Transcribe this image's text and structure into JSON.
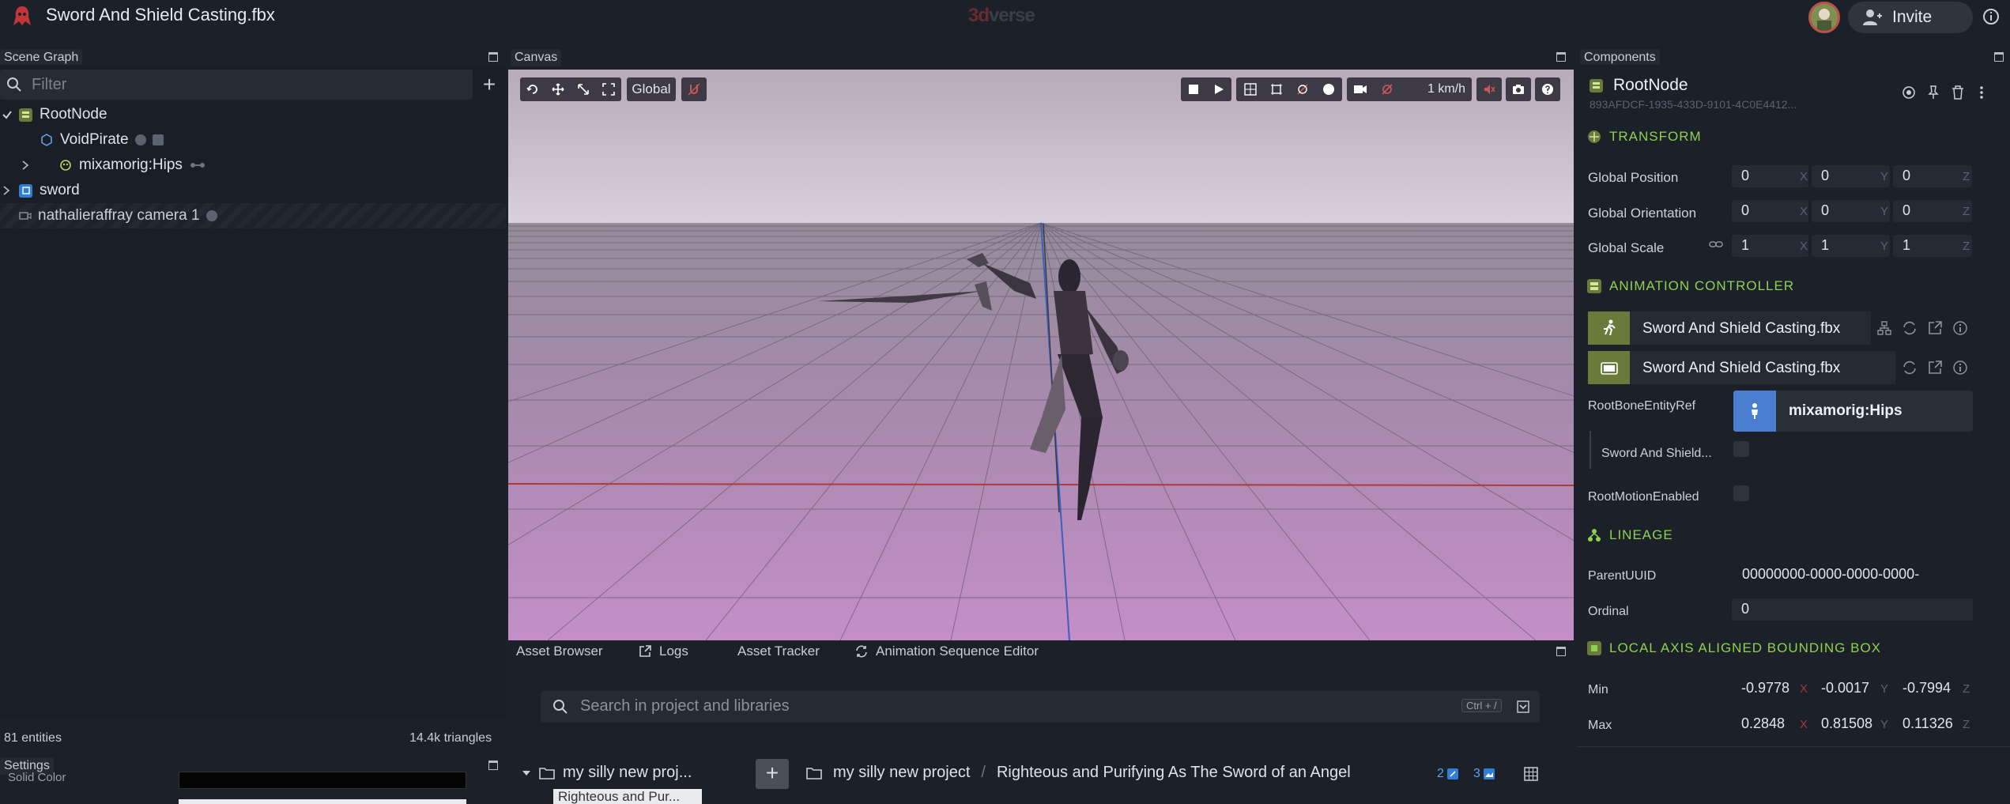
{
  "app": {
    "title": "Sword And Shield Casting.fbx",
    "brand_3d": "3d",
    "brand_rest": "verse",
    "invite_label": "Invite"
  },
  "scene_graph": {
    "tab_label": "Scene Graph",
    "filter_placeholder": "Filter",
    "nodes": [
      {
        "label": "RootNode"
      },
      {
        "label": "VoidPirate"
      },
      {
        "label": "mixamorig:Hips"
      },
      {
        "label": "sword"
      },
      {
        "label": "nathalieraffray camera 1"
      }
    ],
    "entities": "81 entities",
    "triangles": "14.4k triangles"
  },
  "settings": {
    "tab_label": "Settings",
    "solid_color_label": "Solid Color"
  },
  "canvas": {
    "tab_label": "Canvas",
    "space_mode": "Global",
    "speed": "1 km/h"
  },
  "bottom_tabs": [
    "Asset Browser",
    "Logs",
    "Asset Tracker",
    "Animation Sequence Editor"
  ],
  "asset_browser": {
    "search_placeholder": "Search in project and libraries",
    "search_hint": "Ctrl + /",
    "folder_name": "my silly new proj...",
    "tooltip": "Righteous and Pur...",
    "breadcrumb": [
      "my silly new project",
      "/",
      "Righteous and Purifying As The Sword of an Angel"
    ],
    "count_scenes": "2",
    "count_images": "3"
  },
  "components": {
    "tab_label": "Components",
    "entity_name": "RootNode",
    "entity_uuid": "893AFDCF-1935-433D-9101-4C0E4412...",
    "transform": {
      "title": "TRANSFORM",
      "global_position_label": "Global Position",
      "global_position": [
        "0",
        "0",
        "0"
      ],
      "global_orientation_label": "Global Orientation",
      "global_orientation": [
        "0",
        "0",
        "0"
      ],
      "global_scale_label": "Global Scale",
      "global_scale": [
        "1",
        "1",
        "1"
      ],
      "axes": [
        "X",
        "Y",
        "Z"
      ]
    },
    "animation_controller": {
      "title": "ANIMATION CONTROLLER",
      "animation_asset": "Sword And Shield Casting.fbx",
      "skeleton_asset": "Sword And Shield Casting.fbx",
      "root_bone_label": "RootBoneEntityRef",
      "root_bone_value": "mixamorig:Hips",
      "sub_label": "Sword And Shield...",
      "root_motion_label": "RootMotionEnabled"
    },
    "lineage": {
      "title": "LINEAGE",
      "parent_uuid_label": "ParentUUID",
      "parent_uuid": "00000000-0000-0000-0000-",
      "ordinal_label": "Ordinal",
      "ordinal": "0"
    },
    "bbox": {
      "title": "LOCAL AXIS ALIGNED BOUNDING BOX",
      "min_label": "Min",
      "min": [
        "-0.9778",
        "-0.0017",
        "-0.7994"
      ],
      "max_label": "Max",
      "max": [
        "0.2848",
        "0.81508",
        "0.11326"
      ]
    }
  }
}
